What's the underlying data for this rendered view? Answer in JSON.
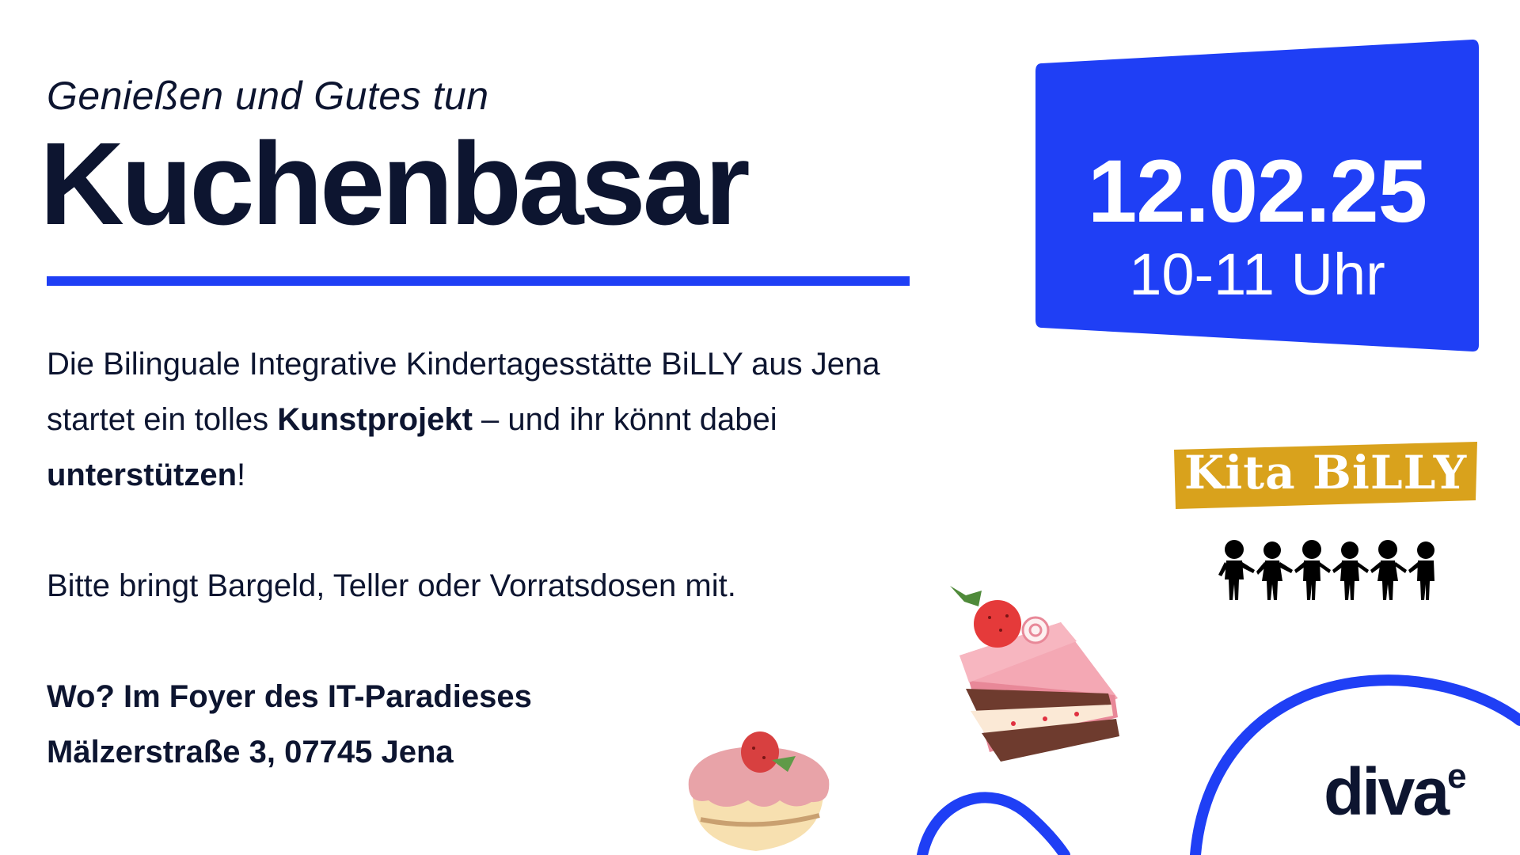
{
  "header": {
    "tagline": "Genießen und Gutes tun",
    "title": "Kuchenbasar"
  },
  "event": {
    "date": "12.02.25",
    "time": "10-11 Uhr"
  },
  "body": {
    "p1_a": "Die Bilinguale Integrative Kindertagesstätte BiLLY aus Jena startet ein tolles ",
    "p1_b": "Kunstprojekt",
    "p1_c": "  – und ihr könnt dabei ",
    "p1_d": "unterstützen",
    "p1_e": "!",
    "p2": "Bitte bringt Bargeld, Teller oder Vorratsdosen mit."
  },
  "location": {
    "line1": "Wo? Im Foyer des IT-Paradieses",
    "line2": "Mälzerstraße 3, 07745 Jena"
  },
  "badge": {
    "text": "Kita BiLLY"
  },
  "logo": {
    "main": "diva",
    "sup": "e"
  },
  "colors": {
    "accent": "#1f3ff5",
    "text": "#0d1530",
    "badge": "#d9a21c"
  },
  "icons": [
    "cake-slice-icon",
    "cupcake-icon",
    "children-silhouette-icon"
  ]
}
